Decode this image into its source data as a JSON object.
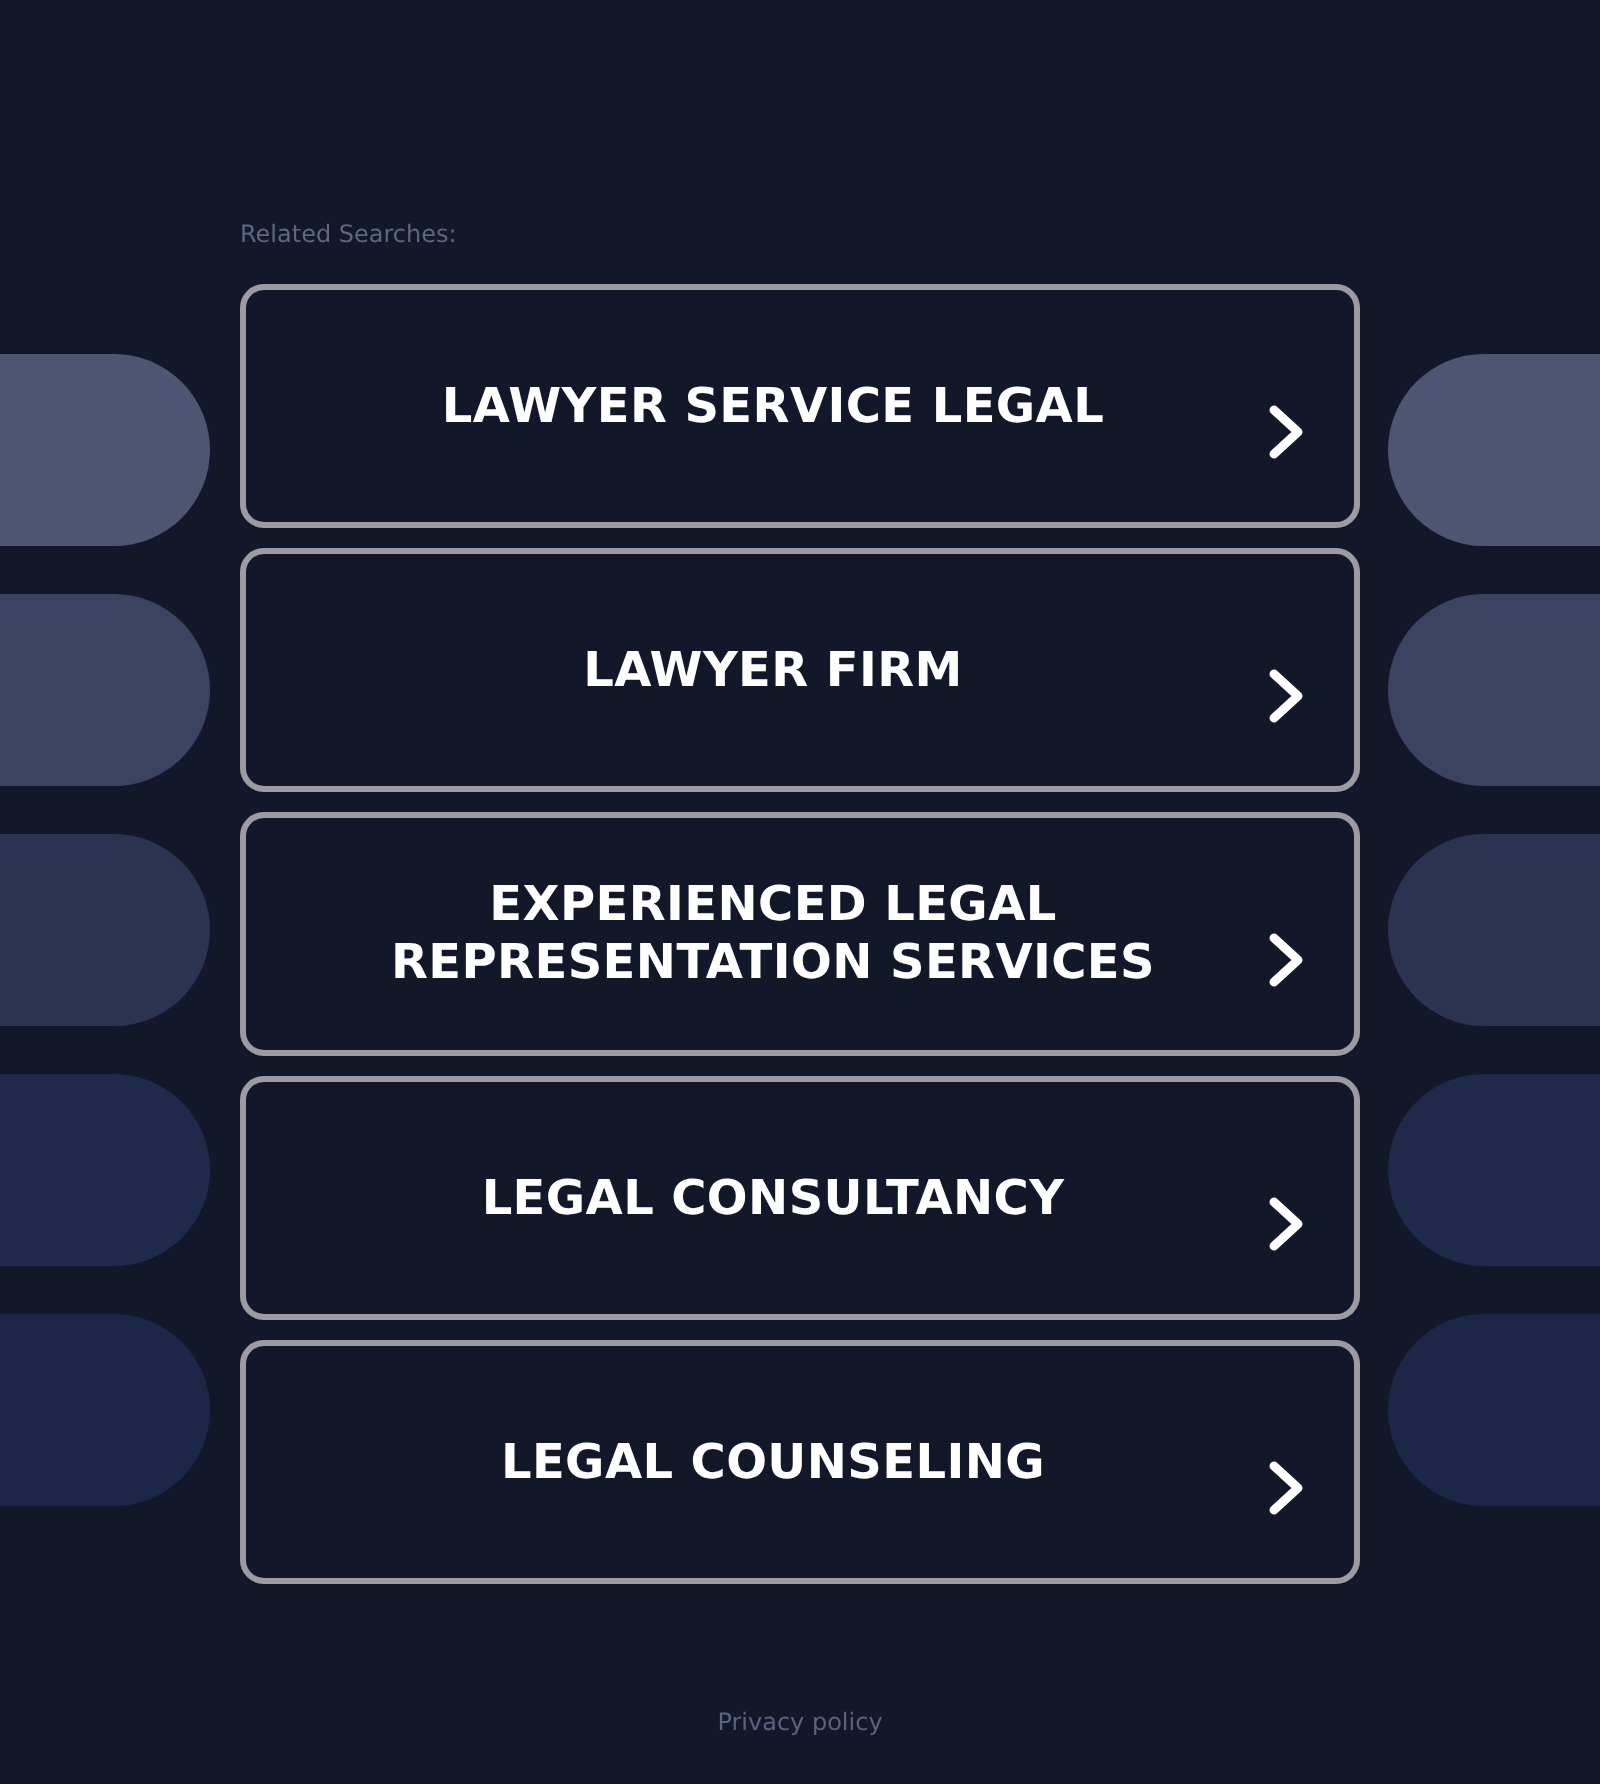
{
  "heading": "Related Searches:",
  "links": [
    {
      "label": "LAWYER SERVICE LEGAL"
    },
    {
      "label": "LAWYER FIRM"
    },
    {
      "label": "EXPERIENCED LEGAL REPRESENTATION SERVICES"
    },
    {
      "label": "LEGAL CONSULTANCY"
    },
    {
      "label": "LEGAL COUNSELING"
    }
  ],
  "footer": {
    "privacy_link": "Privacy policy"
  }
}
